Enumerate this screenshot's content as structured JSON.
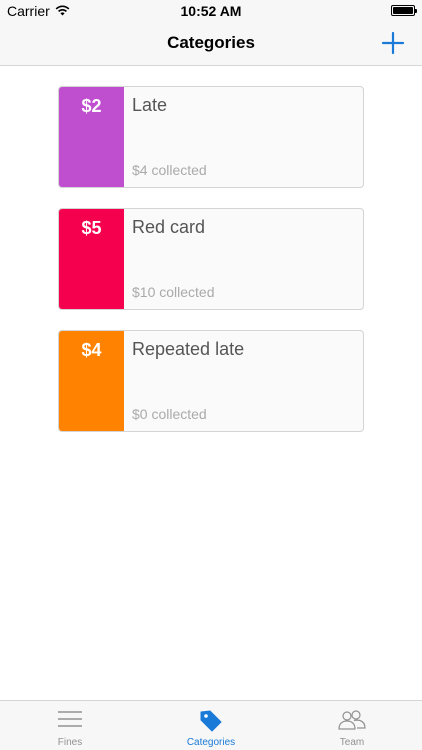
{
  "status_bar": {
    "carrier": "Carrier",
    "time": "10:52 AM",
    "wifi_icon": "wifi-icon",
    "battery_icon": "battery-icon"
  },
  "nav": {
    "title": "Categories",
    "add_icon": "plus-icon",
    "accent_color": "#1a7ad8"
  },
  "categories": [
    {
      "price": "$2",
      "name": "Late",
      "collected": "$4 collected",
      "color": "#c04fd0"
    },
    {
      "price": "$5",
      "name": "Red card",
      "collected": "$10 collected",
      "color": "#f5004f"
    },
    {
      "price": "$4",
      "name": "Repeated late",
      "collected": "$0 collected",
      "color": "#ff8200"
    }
  ],
  "tab_bar": {
    "tabs": [
      {
        "label": "Fines",
        "icon": "list-icon",
        "active": false
      },
      {
        "label": "Categories",
        "icon": "tag-icon",
        "active": true
      },
      {
        "label": "Team",
        "icon": "people-icon",
        "active": false
      }
    ]
  }
}
